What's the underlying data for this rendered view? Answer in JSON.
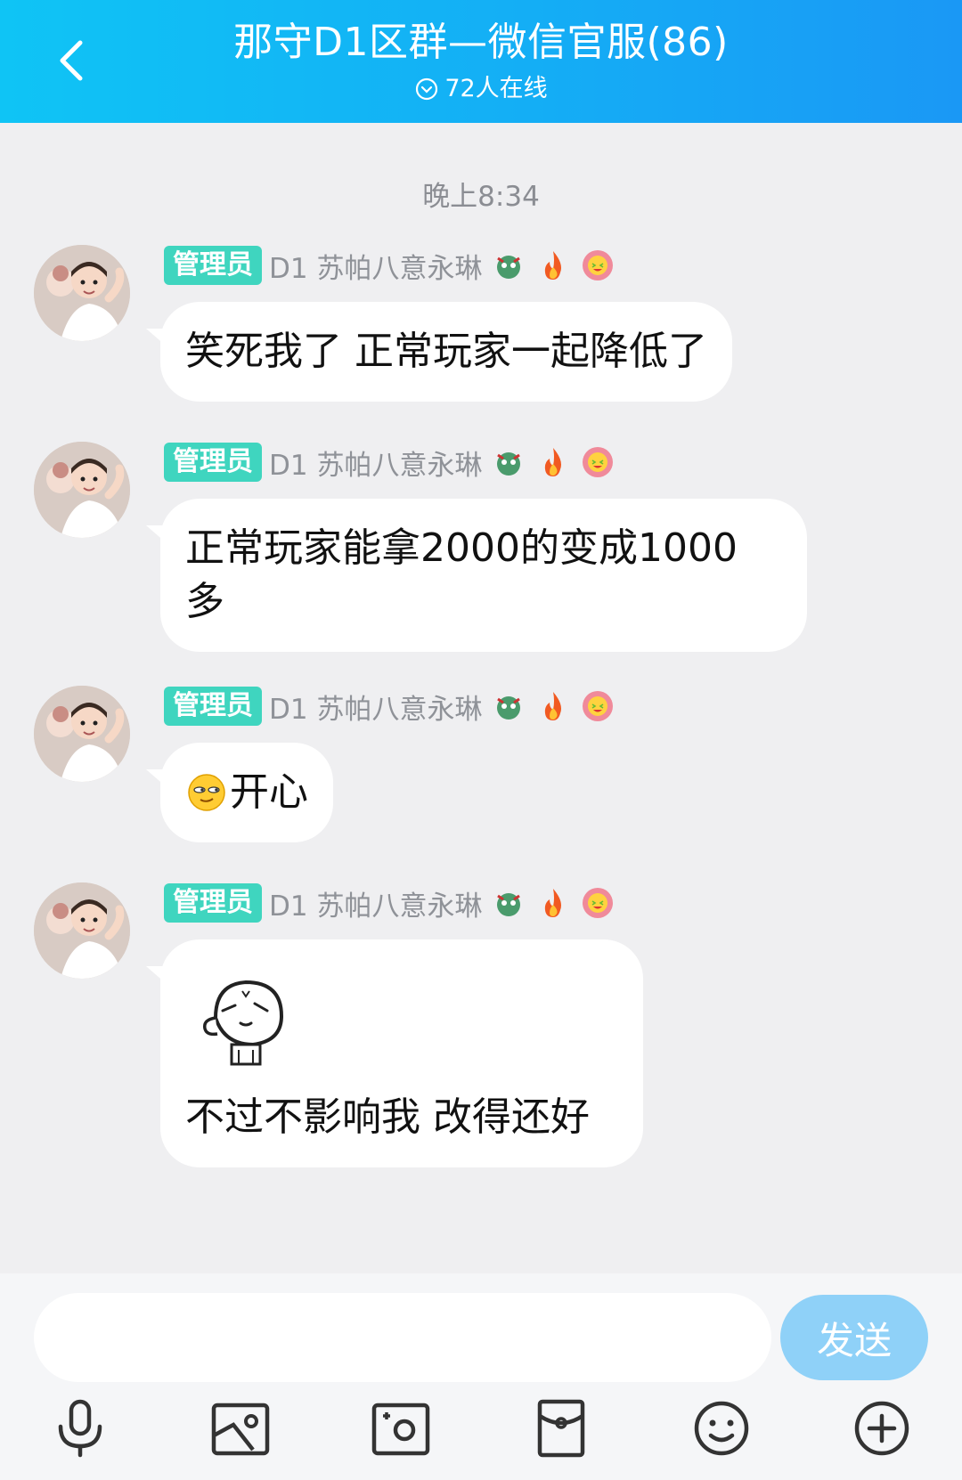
{
  "header": {
    "title": "那守D1区群—微信官服(86)",
    "online": "72人在线"
  },
  "time_label": "晚上8:34",
  "messages": [
    {
      "badge": "管理员",
      "sender": "D1 苏帕八意永琳",
      "text": "笑死我了 正常玩家一起降低了"
    },
    {
      "badge": "管理员",
      "sender": "D1 苏帕八意永琳",
      "text_line1": "正常玩家能拿2000的变成1000",
      "text_line2": "多"
    },
    {
      "badge": "管理员",
      "sender": "D1 苏帕八意永琳",
      "text": "开心"
    },
    {
      "badge": "管理员",
      "sender": "D1 苏帕八意永琳",
      "text": "不过不影响我 改得还好"
    }
  ],
  "input": {
    "placeholder": "",
    "send_label": "发送"
  },
  "toolbar": {
    "icons": [
      "microphone-icon",
      "image-icon",
      "camera-icon",
      "red-packet-icon",
      "emoji-icon",
      "plus-icon"
    ]
  },
  "colors": {
    "header_start": "#0fc4f5",
    "header_end": "#1a98f5",
    "badge": "#3fd5bf",
    "send_button": "#8fd1f8"
  }
}
